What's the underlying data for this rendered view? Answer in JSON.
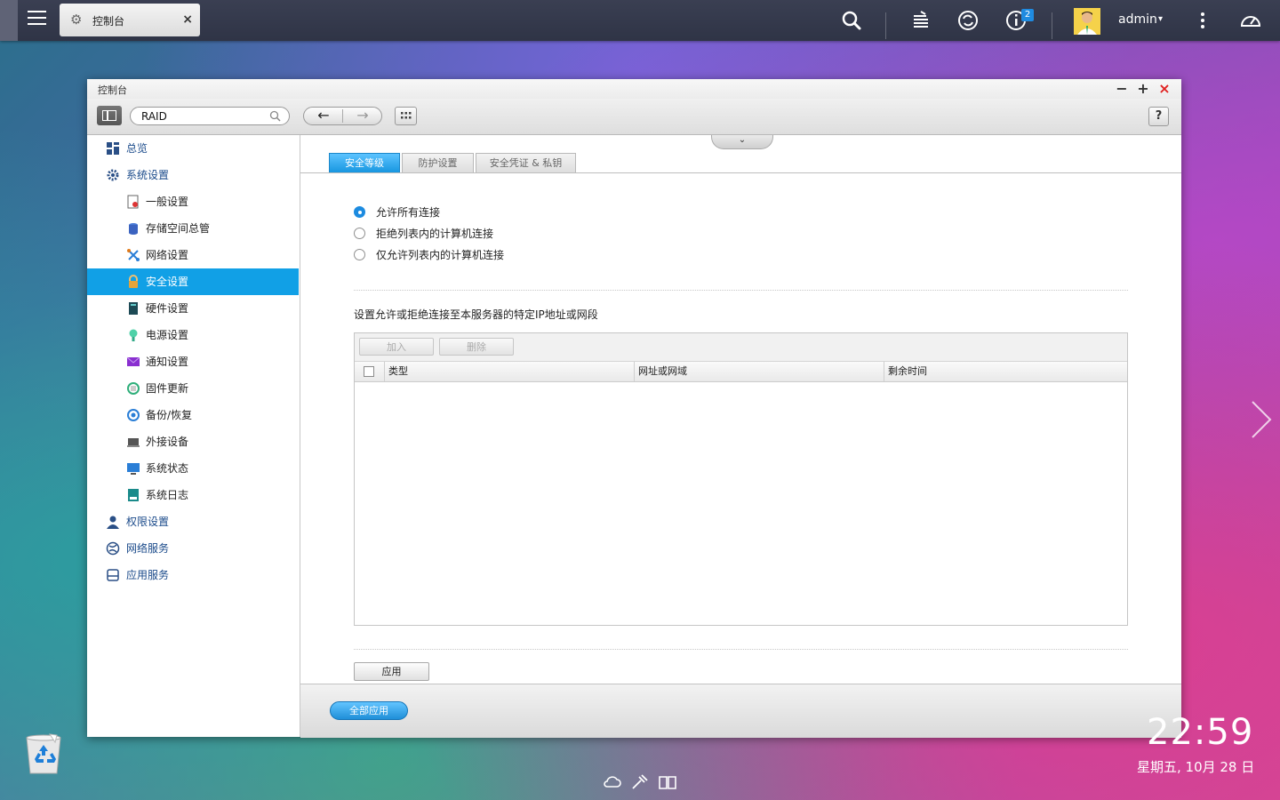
{
  "topbar": {
    "tab_label": "控制台",
    "tab_close": "×",
    "badge_count": "2",
    "username": "admin",
    "user_caret": "▾"
  },
  "window": {
    "title": "控制台",
    "minimize": "−",
    "maximize": "+",
    "close": "×",
    "search_value": "RAID",
    "help_label": "?"
  },
  "sidebar": {
    "items": [
      {
        "label": "总览",
        "icon": "overview-icon"
      },
      {
        "label": "系统设置",
        "icon": "system-settings-icon"
      },
      {
        "label": "一般设置",
        "icon": "general-settings-icon"
      },
      {
        "label": "存储空间总管",
        "icon": "storage-icon"
      },
      {
        "label": "网络设置",
        "icon": "network-icon"
      },
      {
        "label": "安全设置",
        "icon": "security-lock-icon",
        "active": true
      },
      {
        "label": "硬件设置",
        "icon": "hardware-icon"
      },
      {
        "label": "电源设置",
        "icon": "power-icon"
      },
      {
        "label": "通知设置",
        "icon": "notification-icon"
      },
      {
        "label": "固件更新",
        "icon": "firmware-icon"
      },
      {
        "label": "备份/恢复",
        "icon": "backup-icon"
      },
      {
        "label": "外接设备",
        "icon": "external-device-icon"
      },
      {
        "label": "系统状态",
        "icon": "system-status-icon"
      },
      {
        "label": "系统日志",
        "icon": "system-log-icon"
      },
      {
        "label": "权限设置",
        "icon": "privilege-icon"
      },
      {
        "label": "网络服务",
        "icon": "network-service-icon"
      },
      {
        "label": "应用服务",
        "icon": "application-service-icon"
      }
    ]
  },
  "content": {
    "tabs": [
      "安全等级",
      "防护设置",
      "安全凭证 & 私钥"
    ],
    "radios": [
      {
        "label": "允许所有连接",
        "checked": true
      },
      {
        "label": "拒绝列表内的计算机连接",
        "checked": false
      },
      {
        "label": "仅允许列表内的计算机连接",
        "checked": false
      }
    ],
    "section_desc": "设置允许或拒绝连接至本服务器的特定IP地址或网段",
    "add_label": "加入",
    "delete_label": "删除",
    "columns": [
      "类型",
      "网址或网域",
      "剩余时间"
    ],
    "apply_label": "应用",
    "apply_all_label": "全部应用"
  },
  "desktop": {
    "clock": "22:59",
    "date": "星期五, 10月 28 日"
  },
  "colors": {
    "accent": "#11a0e6",
    "topbar": "#353a4c",
    "close_red": "#e0201f"
  }
}
